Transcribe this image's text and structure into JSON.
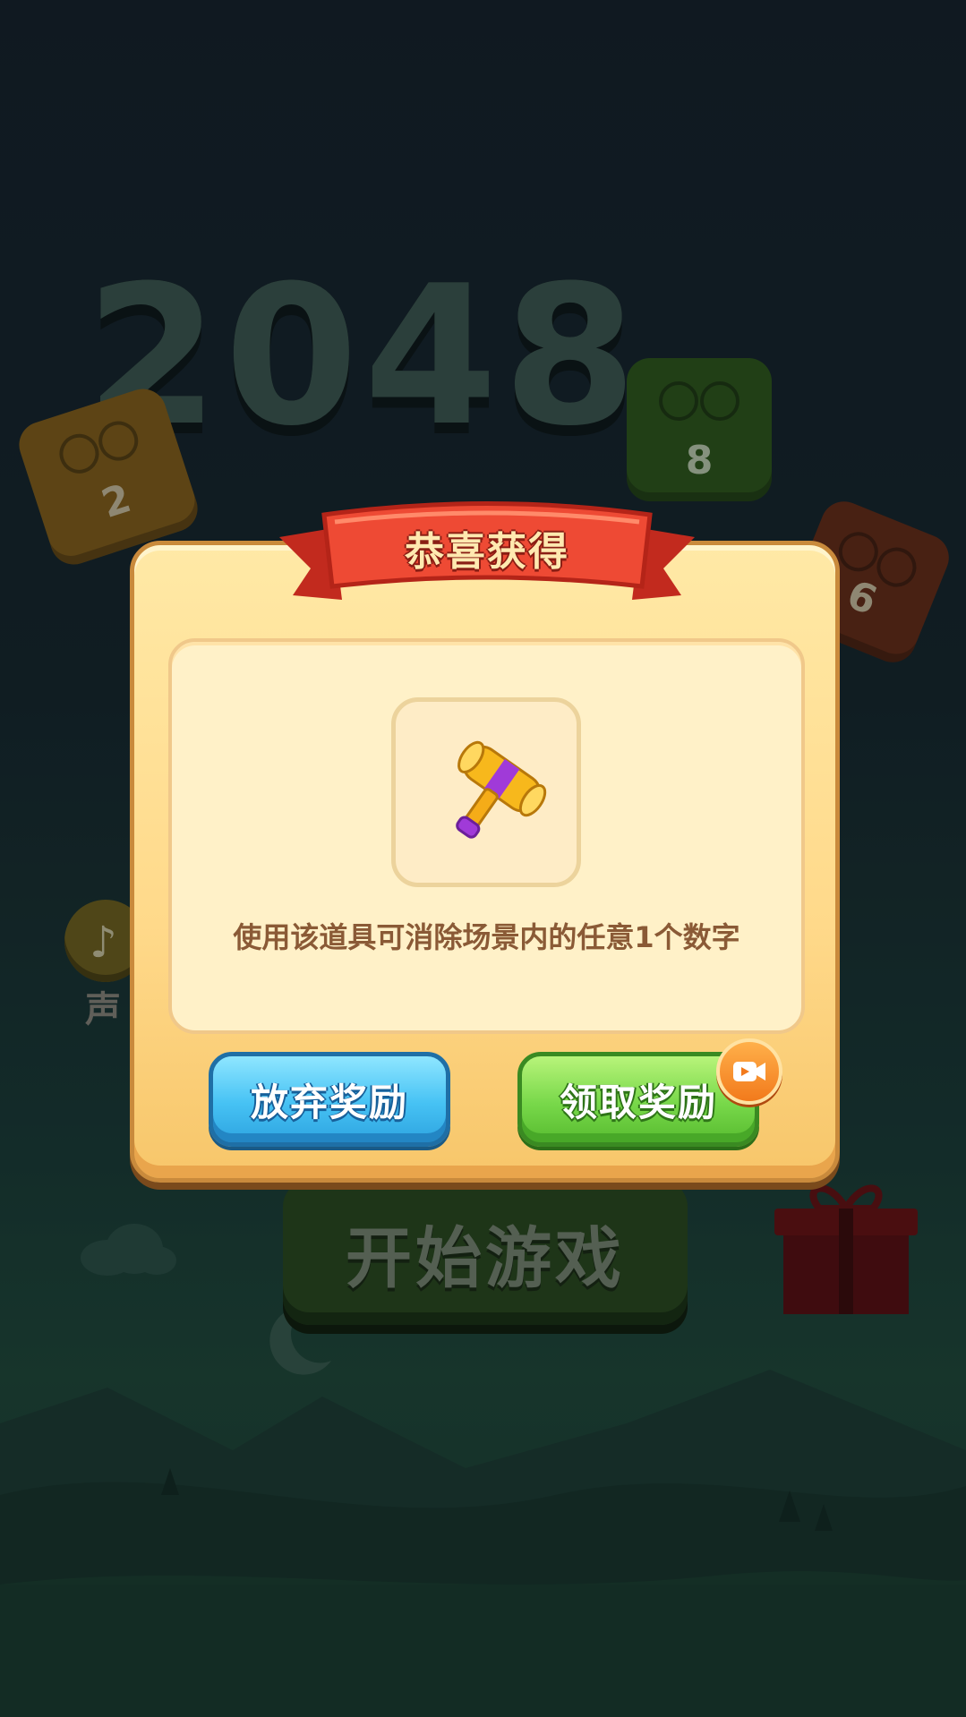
{
  "background": {
    "logo_text": "2048",
    "tiles": [
      {
        "name": "tile-2",
        "value": "2"
      },
      {
        "name": "tile-8",
        "value": "8"
      },
      {
        "name": "tile-16",
        "value": "6"
      }
    ],
    "sound_label": "声",
    "start_button_label": "开始游戏"
  },
  "dialog": {
    "title": "恭喜获得",
    "item_icon": "hammer-icon",
    "item_description": "使用该道具可消除场景内的任意1个数字",
    "buttons": {
      "give_up_label": "放弃奖励",
      "claim_label": "领取奖励",
      "claim_badge_icon": "video-camera-icon"
    }
  },
  "colors": {
    "dialog_bg": "#ffd98a",
    "ribbon_red": "#e8442e",
    "give_up_blue": "#46c2f4",
    "claim_green": "#78d84a",
    "badge_orange": "#f27a1c"
  }
}
